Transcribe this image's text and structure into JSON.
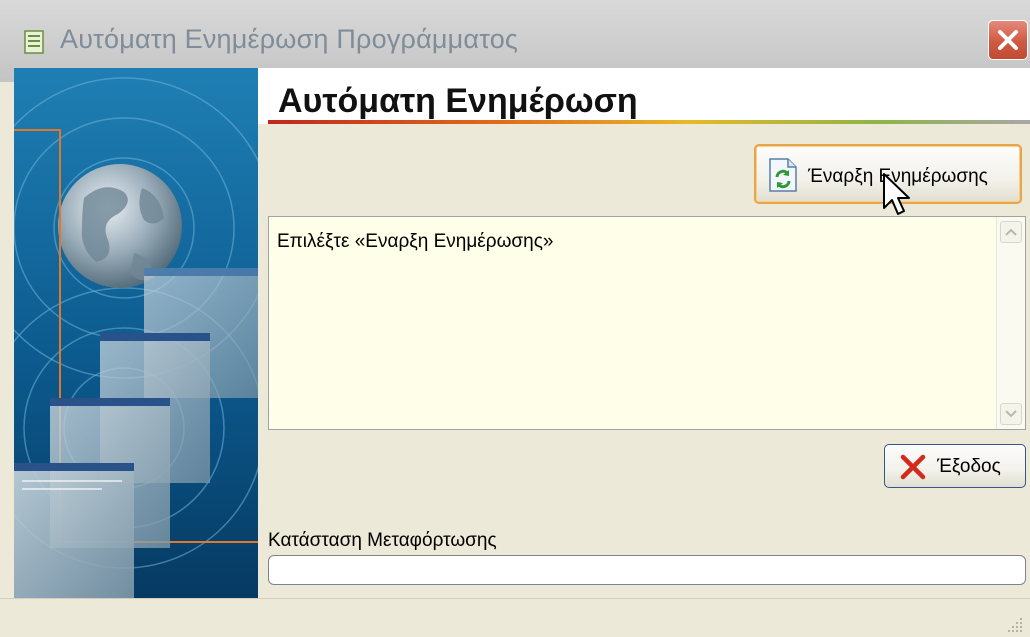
{
  "window": {
    "title": "Αυτόματη Ενημέρωση Προγράμματος",
    "title_icon": "document-icon",
    "close_icon": "close-icon"
  },
  "header": {
    "title": "Αυτόματη Ενημέρωση"
  },
  "buttons": {
    "start_update": {
      "label": "Έναρξη Ενημέρωσης",
      "icon": "refresh-icon"
    },
    "exit": {
      "label": "Έξοδος",
      "icon": "close-x-icon"
    }
  },
  "log": {
    "text": "Επιλέξτε «Εναρξη Ενημέρωσης»"
  },
  "download": {
    "label": "Κατάσταση Μεταφόρτωσης",
    "progress": 0
  },
  "colors": {
    "accent_orange": "#e6a54a",
    "close_red": "#d05a42",
    "panel_blue": "#0d4f7d",
    "log_background": "#fffee8"
  }
}
